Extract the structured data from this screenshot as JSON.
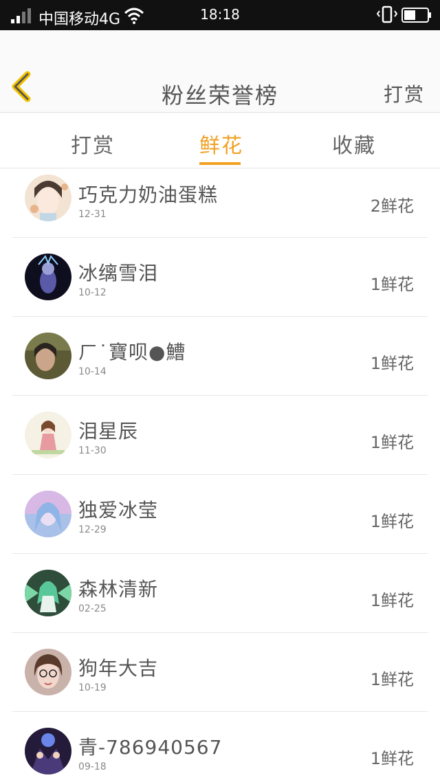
{
  "status_bar": {
    "carrier": "中国移动4G",
    "time": "18:18"
  },
  "header": {
    "title": "粉丝荣誉榜",
    "action_label": "打赏"
  },
  "tabs": [
    {
      "label": "打赏"
    },
    {
      "label": "鲜花"
    },
    {
      "label": "收藏"
    }
  ],
  "active_tab": "鲜花",
  "accent_color": "#f0a122",
  "fans": [
    {
      "name": "巧克力奶油蛋糕",
      "date": "12-31",
      "count": "2鲜花"
    },
    {
      "name": "冰缡雪泪",
      "date": "10-12",
      "count": "1鲜花"
    },
    {
      "name": "ㄏ˙寶呗●鰽",
      "date": "10-14",
      "count": "1鲜花"
    },
    {
      "name": "泪星辰",
      "date": "11-30",
      "count": "1鲜花"
    },
    {
      "name": "独爱冰莹",
      "date": "12-29",
      "count": "1鲜花"
    },
    {
      "name": "森林清新",
      "date": "02-25",
      "count": "1鲜花"
    },
    {
      "name": "狗年大吉",
      "date": "10-19",
      "count": "1鲜花"
    },
    {
      "name": "青-786940567",
      "date": "09-18",
      "count": "1鲜花"
    }
  ]
}
